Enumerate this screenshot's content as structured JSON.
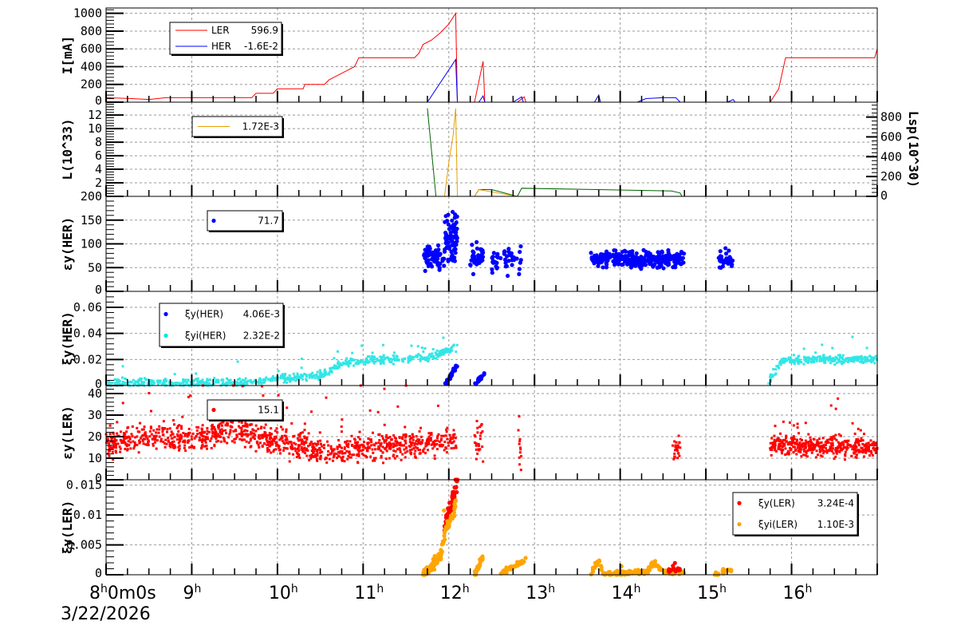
{
  "chart_data": [
    {
      "type": "line",
      "ylabel": "I[mA]",
      "ylim": [
        0,
        1060
      ],
      "yticks": [
        "0",
        "200",
        "400",
        "600",
        "800",
        "1000"
      ],
      "ytick_values": [
        0,
        200,
        400,
        600,
        800,
        1000
      ],
      "legend": [
        {
          "name": "LER",
          "value": "596.9",
          "color": "#ff0000"
        },
        {
          "name": "HER",
          "value": "-1.6E-2",
          "color": "#0000ff"
        }
      ],
      "series": [
        {
          "name": "LER",
          "color": "#ff0000",
          "points": [
            [
              8,
              50
            ],
            [
              8.3,
              40
            ],
            [
              8.5,
              30
            ],
            [
              8.7,
              50
            ],
            [
              9.7,
              50
            ],
            [
              9.75,
              100
            ],
            [
              9.95,
              100
            ],
            [
              10.0,
              150
            ],
            [
              10.3,
              150
            ],
            [
              10.32,
              200
            ],
            [
              10.55,
              200
            ],
            [
              10.6,
              250
            ],
            [
              10.7,
              300
            ],
            [
              10.8,
              350
            ],
            [
              10.9,
              400
            ],
            [
              10.95,
              500
            ],
            [
              11.6,
              500
            ],
            [
              11.65,
              550
            ],
            [
              11.7,
              650
            ],
            [
              11.8,
              700
            ],
            [
              11.9,
              780
            ],
            [
              12.0,
              880
            ],
            [
              12.08,
              1000
            ],
            [
              12.1,
              0
            ],
            [
              12.3,
              0
            ],
            [
              12.4,
              460
            ],
            [
              12.42,
              0
            ],
            [
              12.8,
              0
            ],
            [
              12.88,
              60
            ],
            [
              12.9,
              0
            ],
            [
              15.75,
              0
            ],
            [
              15.85,
              150
            ],
            [
              15.93,
              500
            ],
            [
              16.97,
              500
            ],
            [
              17.0,
              600
            ]
          ]
        },
        {
          "name": "HER",
          "color": "#0000ff",
          "points": [
            [
              8,
              0
            ],
            [
              11.75,
              0
            ],
            [
              12.08,
              480
            ],
            [
              12.1,
              0
            ],
            [
              12.35,
              0
            ],
            [
              12.4,
              70
            ],
            [
              12.42,
              0
            ],
            [
              12.75,
              0
            ],
            [
              12.85,
              60
            ],
            [
              12.87,
              0
            ],
            [
              13.7,
              0
            ],
            [
              13.75,
              80
            ],
            [
              13.77,
              0
            ],
            [
              14.2,
              0
            ],
            [
              14.3,
              40
            ],
            [
              14.5,
              50
            ],
            [
              14.65,
              50
            ],
            [
              14.7,
              0
            ],
            [
              15.25,
              0
            ],
            [
              15.32,
              30
            ],
            [
              15.34,
              0
            ],
            [
              17,
              0
            ]
          ]
        }
      ]
    },
    {
      "type": "line",
      "ylabel": "L(10^33)",
      "ylim": [
        0,
        13.9
      ],
      "yticks": [
        "2",
        "4",
        "6",
        "8",
        "10",
        "12"
      ],
      "ytick_values": [
        2,
        4,
        6,
        8,
        10,
        12
      ],
      "y2label": "Lsp(10^30)",
      "y2lim": [
        0,
        950
      ],
      "y2ticks": [
        "0",
        "200",
        "400",
        "600",
        "800"
      ],
      "y2tick_values": [
        0,
        200,
        400,
        600,
        800
      ],
      "legend": [
        {
          "name": "",
          "value": "1.72E-3",
          "color": "#e6a000"
        }
      ],
      "series": [
        {
          "name": "L",
          "color": "#006400",
          "points": [
            [
              11.75,
              13
            ],
            [
              11.85,
              0
            ],
            [
              12.3,
              0
            ],
            [
              12.35,
              1
            ],
            [
              12.5,
              1
            ],
            [
              12.8,
              0
            ],
            [
              12.85,
              1.2
            ],
            [
              14.6,
              0.8
            ],
            [
              14.7,
              0.5
            ],
            [
              14.72,
              0
            ]
          ]
        },
        {
          "name": "Lsp",
          "color": "#e6a000",
          "points": [
            [
              9.5,
              0
            ],
            [
              11.95,
              0
            ],
            [
              12.0,
              5
            ],
            [
              12.05,
              9
            ],
            [
              12.08,
              13
            ],
            [
              12.1,
              0
            ],
            [
              12.3,
              0
            ],
            [
              12.35,
              1
            ],
            [
              12.8,
              0
            ],
            [
              14.7,
              0
            ]
          ]
        }
      ]
    },
    {
      "type": "scatter",
      "ylabel": "εy(HER)",
      "ylim": [
        0,
        200
      ],
      "yticks": [
        "0",
        "50",
        "100",
        "150",
        "200"
      ],
      "ytick_values": [
        0,
        50,
        100,
        150,
        200
      ],
      "legend": [
        {
          "name": "",
          "value": "71.7",
          "color": "#0000ff"
        }
      ],
      "series": [
        {
          "name": "εy(HER)",
          "color": "#0000ff",
          "marker": "circle",
          "clusters": [
            [
              11.7,
              11.95,
              70,
              12,
              70
            ],
            [
              11.95,
              12.1,
              115,
              25,
              70
            ],
            [
              12.25,
              12.4,
              70,
              14,
              45
            ],
            [
              12.5,
              12.85,
              68,
              14,
              45
            ],
            [
              13.65,
              14.75,
              68,
              8,
              300
            ],
            [
              15.15,
              15.32,
              65,
              10,
              30
            ]
          ]
        }
      ]
    },
    {
      "type": "scatter",
      "ylabel": "ξy(HER)",
      "ylim": [
        0,
        0.0722
      ],
      "yticks": [
        "0",
        "0.02",
        "0.04",
        "0.06"
      ],
      "ytick_values": [
        0,
        0.02,
        0.04,
        0.06
      ],
      "legend": [
        {
          "name": "ξy(HER)",
          "value": "4.06E-3",
          "color": "#0000ff"
        },
        {
          "name": "ξyi(HER)",
          "value": "2.32E-2",
          "color": "#00e5e5"
        }
      ],
      "series": [
        {
          "name": "ξyi(HER)",
          "color": "#33e6e6",
          "marker": "square",
          "trend": [
            [
              8,
              0.002
            ],
            [
              9.5,
              0.002
            ],
            [
              10,
              0.005
            ],
            [
              10.5,
              0.008
            ],
            [
              10.8,
              0.018
            ],
            [
              11.8,
              0.022
            ],
            [
              12.1,
              0.03
            ]
          ],
          "spread": 0.0015,
          "n": 700
        },
        {
          "name": "ξyi(HER) after",
          "color": "#33e6e6",
          "marker": "square",
          "trend": [
            [
              15.72,
              0.002
            ],
            [
              15.9,
              0.02
            ],
            [
              17,
              0.02
            ]
          ],
          "spread": 0.0015,
          "n": 260
        },
        {
          "name": "ξy(HER)",
          "color": "#0000ff",
          "marker": "circle",
          "trend": [
            [
              11.95,
              0
            ],
            [
              12.1,
              0.016
            ]
          ],
          "spread": 0.001,
          "n": 30
        },
        {
          "name": "ξy(HER) b",
          "color": "#0000ff",
          "marker": "circle",
          "trend": [
            [
              12.3,
              0
            ],
            [
              12.42,
              0.01
            ]
          ],
          "spread": 0.001,
          "n": 20
        }
      ]
    },
    {
      "type": "scatter",
      "ylabel": "εy(LER)",
      "ylim": [
        0,
        43.7
      ],
      "yticks": [
        "0",
        "10",
        "20",
        "30",
        "40"
      ],
      "ytick_values": [
        0,
        10,
        20,
        30,
        40
      ],
      "legend": [
        {
          "name": "",
          "value": "15.1",
          "color": "#ff0000"
        }
      ],
      "series": [
        {
          "name": "εy(LER)",
          "color": "#ff0000",
          "marker": "square",
          "trend": [
            [
              8,
              17
            ],
            [
              8.5,
              20
            ],
            [
              9,
              18
            ],
            [
              9.5,
              24
            ],
            [
              9.8,
              19
            ],
            [
              10.3,
              15
            ],
            [
              10.5,
              13
            ],
            [
              11.5,
              16
            ],
            [
              12.1,
              19
            ]
          ],
          "spread": 3,
          "n": 1100
        },
        {
          "name": "εy(LER) after",
          "color": "#ff0000",
          "marker": "square",
          "trend": [
            [
              15.75,
              16
            ],
            [
              17,
              15
            ]
          ],
          "spread": 2.2,
          "n": 400
        },
        {
          "name": "εy(LER) mid",
          "color": "#ff0000",
          "marker": "square",
          "clusters": [
            [
              12.3,
              12.4,
              18,
              6,
              25
            ],
            [
              12.8,
              12.85,
              18,
              6,
              12
            ],
            [
              14.6,
              14.7,
              15,
              3,
              25
            ]
          ]
        }
      ]
    },
    {
      "type": "scatter",
      "ylabel": "ξy(LER)",
      "ylim": [
        0,
        0.0159
      ],
      "yticks": [
        "0",
        "0.005",
        "0.01",
        "0.015"
      ],
      "ytick_values": [
        0,
        0.005,
        0.01,
        0.015
      ],
      "legend": [
        {
          "name": "ξy(LER)",
          "value": "3.24E-4",
          "color": "#ff0000"
        },
        {
          "name": "ξyi(LER)",
          "value": "1.10E-3",
          "color": "#ffa500"
        }
      ],
      "series": [
        {
          "name": "ξy(LER)",
          "color": "#ff0000",
          "marker": "circle",
          "trend": [
            [
              11.95,
              0.008
            ],
            [
              12.1,
              0.015
            ]
          ],
          "spread": 0.0008,
          "n": 60
        },
        {
          "name": "ξyi(LER)",
          "color": "#ffa500",
          "marker": "circle",
          "trend": [
            [
              11.7,
              0
            ],
            [
              11.9,
              0.003
            ],
            [
              11.95,
              0.007
            ],
            [
              12.05,
              0.01
            ],
            [
              12.08,
              0.012
            ]
          ],
          "spread": 0.0005,
          "n": 120
        },
        {
          "name": "ξyi(LER) b",
          "color": "#ffa500",
          "marker": "circle",
          "trend": [
            [
              12.3,
              0
            ],
            [
              12.4,
              0.003
            ]
          ],
          "spread": 0.0003,
          "n": 30
        },
        {
          "name": "ξyi(LER) c",
          "color": "#ffa500",
          "marker": "circle",
          "trend": [
            [
              12.6,
              0.0002
            ],
            [
              12.9,
              0.0025
            ]
          ],
          "spread": 0.0002,
          "n": 40
        },
        {
          "name": "ξyi(LER) d",
          "color": "#ffa500",
          "marker": "circle",
          "trend": [
            [
              13.65,
              0
            ],
            [
              13.75,
              0.0025
            ],
            [
              13.8,
              0.0002
            ],
            [
              14.3,
              0.0005
            ],
            [
              14.4,
              0.002
            ],
            [
              14.5,
              0.0005
            ],
            [
              14.75,
              0.0003
            ]
          ],
          "spread": 0.0002,
          "n": 160
        },
        {
          "name": "ξy(LER) d",
          "color": "#ff0000",
          "marker": "circle",
          "trend": [
            [
              14.55,
              0.0008
            ],
            [
              14.7,
              0.0008
            ]
          ],
          "spread": 0.0002,
          "n": 20
        },
        {
          "name": "ξyi(LER) e",
          "color": "#ffa500",
          "marker": "circle",
          "trend": [
            [
              15.1,
              0
            ],
            [
              15.3,
              0.001
            ]
          ],
          "spread": 0.0002,
          "n": 20
        }
      ]
    }
  ],
  "xaxis": {
    "xlim": [
      8,
      17
    ],
    "ticks": [
      {
        "h": "8",
        "rest": "0m0s"
      },
      {
        "h": "9"
      },
      {
        "h": "10"
      },
      {
        "h": "11"
      },
      {
        "h": "12"
      },
      {
        "h": "13"
      },
      {
        "h": "14"
      },
      {
        "h": "15"
      },
      {
        "h": "16"
      }
    ],
    "date": "3/22/2026"
  }
}
